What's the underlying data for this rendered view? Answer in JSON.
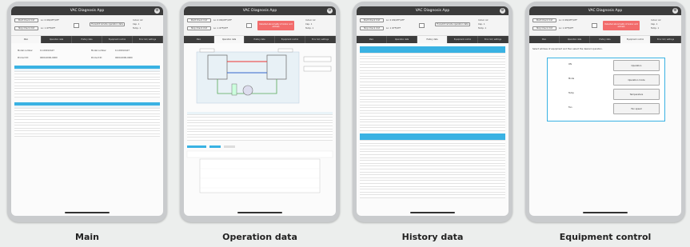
{
  "app": {
    "title": "VAC Diagnosis App"
  },
  "control_panel": {
    "left_buttons": [
      "Start Check Unit",
      "Stop Check Unit"
    ],
    "left_values": [
      "Lo: 0 ON/OFF/OFF",
      "Lo: 1 OFF/OFF"
    ],
    "center_button": "Transmit remote operation data",
    "alarm_text": "Detected abnormality of indoor unit address",
    "status_lines": [
      "Indoor Air",
      "Cap. 1",
      "Temp. 1"
    ]
  },
  "tabs": [
    "Main",
    "Operation data",
    "History data",
    "Equipment control",
    "Error list / settings"
  ],
  "main_screen": {
    "fields": [
      {
        "label": "Model number",
        "value": "1C-0001CA07"
      },
      {
        "label": "Model number",
        "value": "1C-0001CA07"
      },
      {
        "label": "Product ID",
        "value": "0000-0000-0000"
      },
      {
        "label": "Product ID",
        "value": "0000-0000-0000"
      }
    ]
  },
  "equipment_control": {
    "note": "Select address of equipment and then select the desired operation.",
    "rows": [
      {
        "label": "ON",
        "button": "Operation"
      },
      {
        "label": "Mode",
        "button": "Operation mode"
      },
      {
        "label": "Temp",
        "button": "Temperature"
      },
      {
        "label": "Fan",
        "button": "Fan speed"
      }
    ]
  },
  "captions": [
    "Main",
    "Operation data",
    "History data",
    "Equipment control"
  ],
  "colors": {
    "accent": "#39b2e3",
    "alarm": "#f26b6b",
    "titlebar": "#3b3b3b",
    "tablet": "#c9cbcd"
  }
}
